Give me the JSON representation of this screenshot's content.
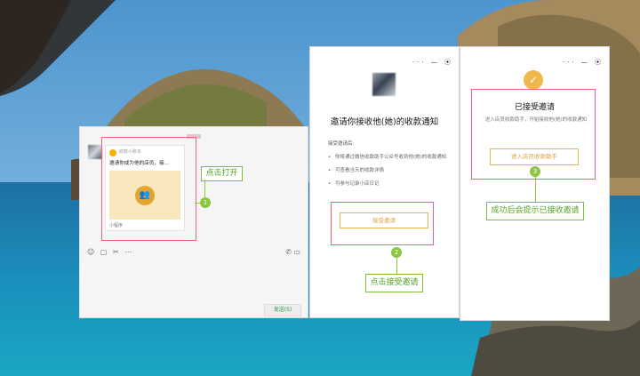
{
  "chat": {
    "source": "收款小账本",
    "message_title": "邀请你成为他的店员，接...",
    "footer": "小程序",
    "send_label": "发送(S)"
  },
  "labels": {
    "click_open": "点击打开",
    "click_accept": "点击接受邀请",
    "success_hint": "成功后会提示已接收邀请"
  },
  "steps": [
    "1",
    "2",
    "3"
  ],
  "invite": {
    "title": "邀请你接收他(她)的收款通知",
    "subtitle": "接受邀请后:",
    "items": [
      "你将通过微信收款助手公众号收到他(她)的收款通知",
      "可查看当天的收款详情",
      "可参与记录小店日记"
    ],
    "accept_button": "接受邀请"
  },
  "accepted": {
    "title": "已接受邀请",
    "description": "进入店员收款助手，开始接收他(她)的收款通知",
    "enter_button": "进入店员收款助手"
  },
  "window_controls": "···  —  ⦿",
  "icons": {
    "toolbar": "☺ ▢ ✂ ⋯",
    "toolbar_right": "✆ ▭",
    "check": "✓",
    "group": "👥"
  }
}
